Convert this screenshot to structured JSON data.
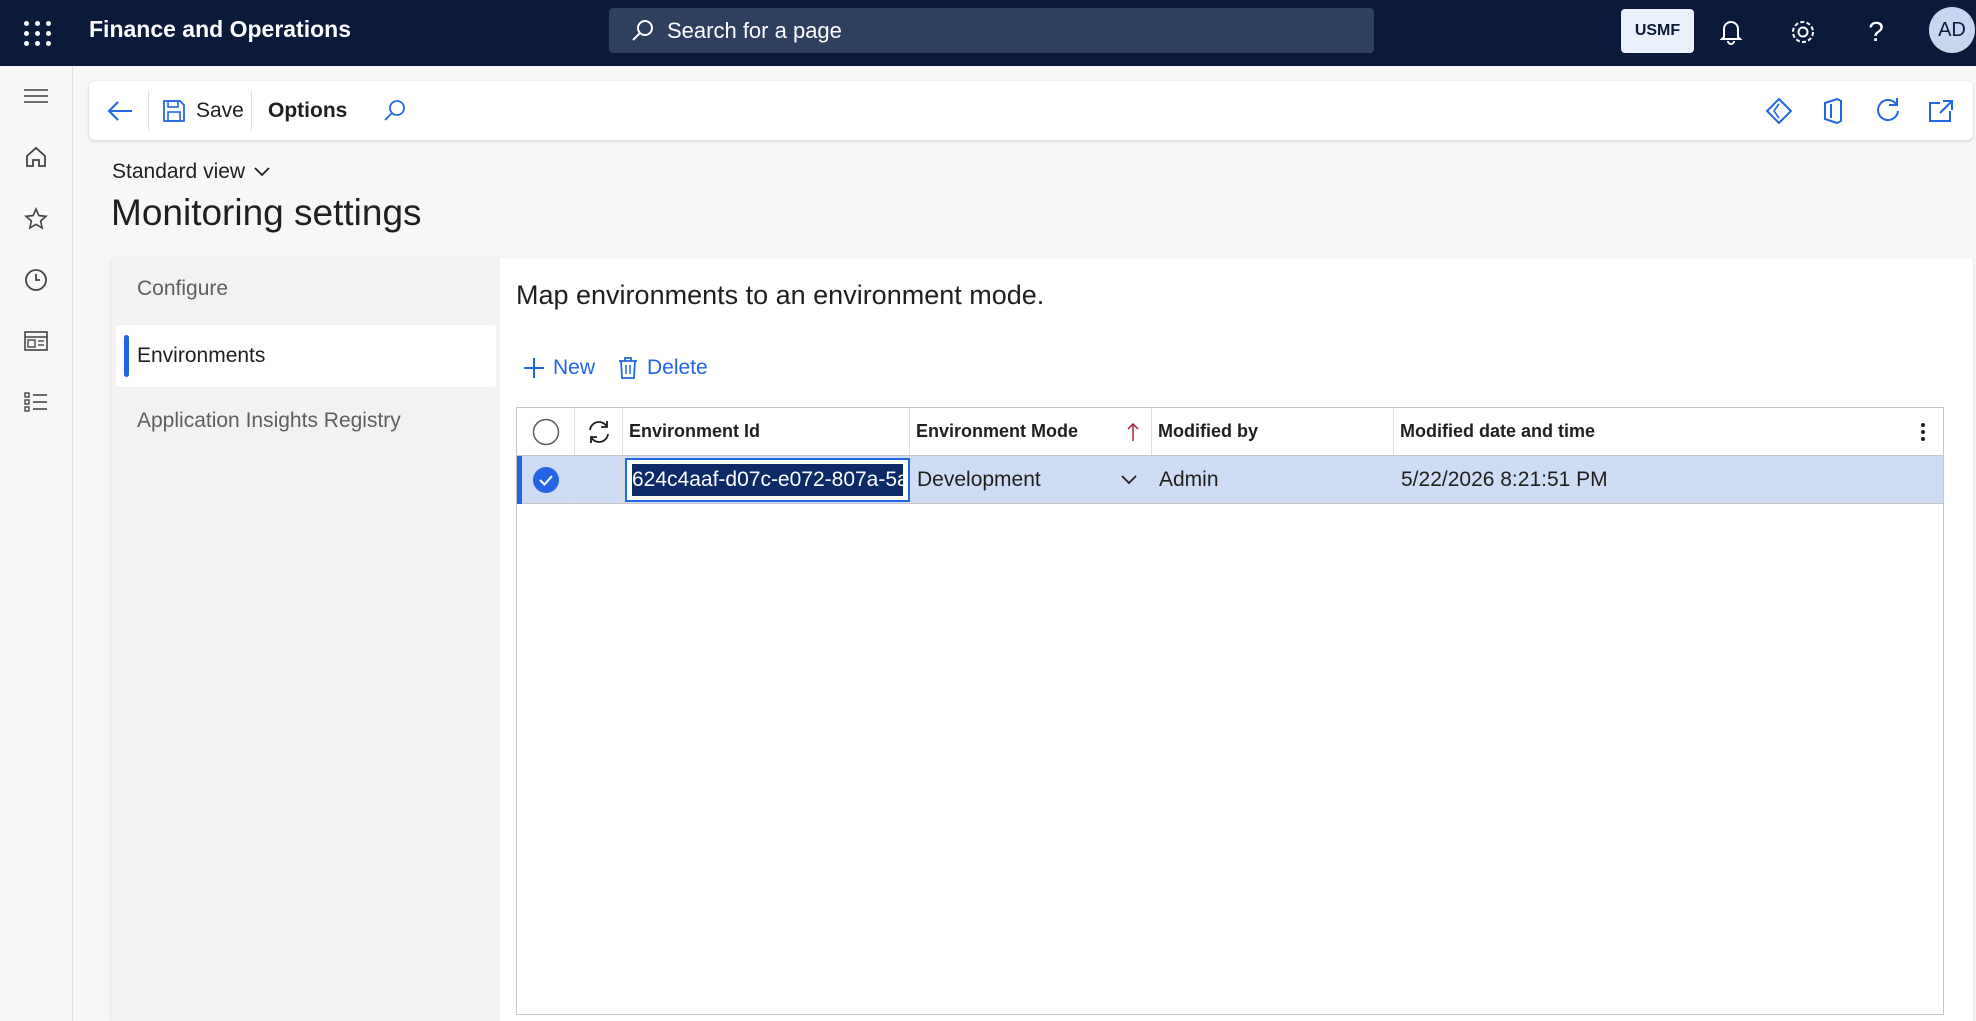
{
  "topbar": {
    "app_title": "Finance and Operations",
    "search_placeholder": "Search for a page",
    "company": "USMF",
    "avatar_initials": "AD"
  },
  "actionbar": {
    "save_label": "Save",
    "options_label": "Options"
  },
  "page": {
    "view_selector": "Standard view",
    "title": "Monitoring settings"
  },
  "tabs": [
    {
      "label": "Configure",
      "selected": false
    },
    {
      "label": "Environments",
      "selected": true
    },
    {
      "label": "Application Insights Registry",
      "selected": false
    }
  ],
  "main": {
    "heading": "Map environments to an environment mode.",
    "new_label": "New",
    "delete_label": "Delete"
  },
  "grid": {
    "columns": [
      "Environment Id",
      "Environment Mode",
      "Modified by",
      "Modified date and time"
    ],
    "rows": [
      {
        "environment_id": "624c4aaf-d07c-e072-807a-5a",
        "environment_mode": "Development",
        "modified_by": "Admin",
        "modified_datetime": "5/22/2026 8:21:51 PM",
        "selected": true
      }
    ]
  },
  "colors": {
    "topbar_bg": "#0b1a3b",
    "accent": "#2266e3",
    "selected_row": "#cfdcf5"
  }
}
